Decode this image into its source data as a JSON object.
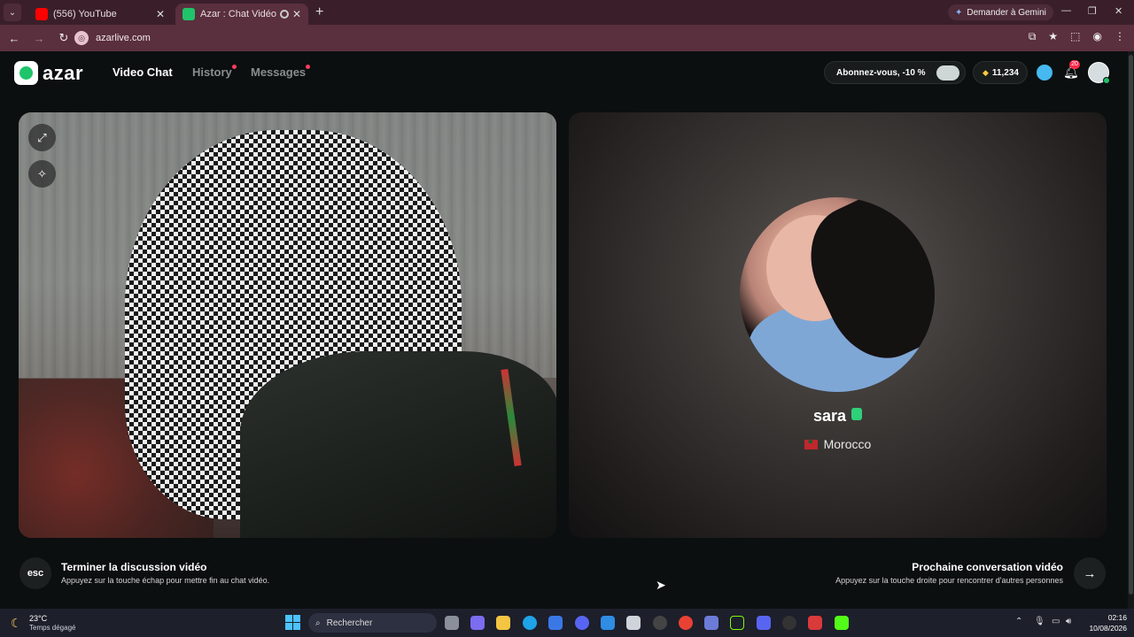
{
  "browser": {
    "tabs": [
      {
        "title": "(556) YouTube",
        "favicon_color": "#ff0000"
      },
      {
        "title": "Azar : Chat Vidéo avec de n",
        "favicon_color": "#1fc46b"
      }
    ],
    "url": "azarlive.com",
    "gemini_label": "Demander à Gemini"
  },
  "app": {
    "logo_text": "azar",
    "nav": {
      "video_chat": "Video Chat",
      "history": "History",
      "messages": "Messages"
    },
    "subscribe_label": "Abonnez-vous, -10 %",
    "coins": "11,234",
    "notifications_count": "20"
  },
  "remote": {
    "username": "sara",
    "country": "Morocco"
  },
  "controls": {
    "esc_label": "esc",
    "end_title": "Terminer la discussion vidéo",
    "end_subtitle": "Appuyez sur la touche échap pour mettre fin au chat vidéo.",
    "next_title": "Prochaine conversation vidéo",
    "next_subtitle": "Appuyez sur la touche droite pour rencontrer d'autres personnes"
  },
  "taskbar": {
    "temperature": "23°C",
    "weather": "Temps dégagé",
    "search_placeholder": "Rechercher",
    "time": "02:16",
    "date": "10/08/2026"
  },
  "colors": {
    "accent_green": "#1fc46b",
    "notification_red": "#ff3b5c",
    "browser_frame": "#5a2f3e"
  }
}
